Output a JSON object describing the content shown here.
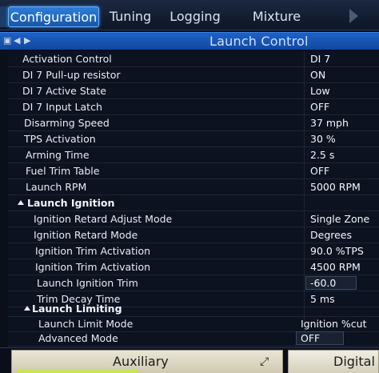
{
  "tabs": [
    {
      "label": "Configuration",
      "active": true
    },
    {
      "label": "Tuning",
      "active": false
    },
    {
      "label": "Logging",
      "active": false
    },
    {
      "label": "Mixture Map",
      "active": false
    }
  ],
  "panel": {
    "title": "Launch Control",
    "header_icons": [
      "lock-icon",
      "arrow-left-icon",
      "arrow-right-icon"
    ]
  },
  "rows": [
    {
      "label": "Activation Control",
      "value": "DI 7"
    },
    {
      "label": "DI 7 Pull-up resistor",
      "value": "ON"
    },
    {
      "label": "DI 7 Active State",
      "value": "Low"
    },
    {
      "label": "DI 7 Input Latch",
      "value": "OFF"
    },
    {
      "label": "Disarming Speed",
      "value": "37 mph"
    },
    {
      "label": "TPS Activation",
      "value": "30 %"
    },
    {
      "label": "Arming Time",
      "value": "2.5 s"
    },
    {
      "label": "Fuel Trim Table",
      "value": "OFF"
    },
    {
      "label": "Launch RPM",
      "value": "5000 RPM"
    },
    {
      "label": "Launch Ignition",
      "value": ""
    },
    {
      "label": "Ignition Retard Adjust Mode",
      "value": "Single Zone"
    },
    {
      "label": "Ignition Retard Mode",
      "value": "Degrees"
    },
    {
      "label": "Ignition Trim Activation",
      "value": "90.0 %TPS"
    },
    {
      "label": "Ignition Trim Activation",
      "value": "4500 RPM"
    },
    {
      "label": "Launch Ignition Trim",
      "value": "-60.0"
    },
    {
      "label": "Trim Decay Time",
      "value": "5 ms"
    },
    {
      "label": "Launch Limiting",
      "value": ""
    },
    {
      "label": "Launch Limit Mode",
      "value": "Ignition %cut"
    },
    {
      "label": "Advanced Mode",
      "value": "OFF"
    }
  ],
  "bottom_tabs": {
    "auxiliary": "Auxiliary",
    "digital": "Digital"
  },
  "colors": {
    "accent": "#1d62c7",
    "active_tab": "#2f7fd6",
    "background": "#0d1220"
  }
}
